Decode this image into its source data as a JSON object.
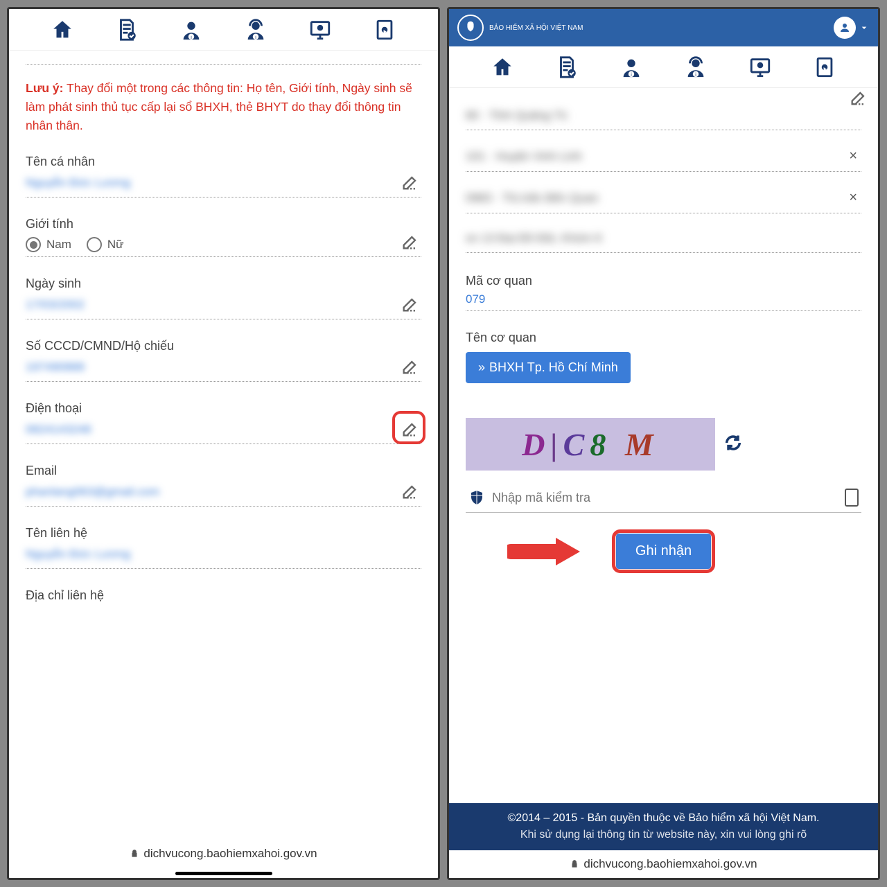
{
  "left": {
    "note_bold": "Lưu ý:",
    "note_text": " Thay đổi một trong các thông tin: Họ tên, Giới tính, Ngày sinh sẽ làm phát sinh thủ tục cấp lại sổ BHXH, thẻ BHYT do thay đổi thông tin nhân thân.",
    "fields": {
      "name_label": "Tên cá nhân",
      "name_value": "Nguyễn Đức Lương",
      "gender_label": "Giới tính",
      "gender_male": "Nam",
      "gender_female": "Nữ",
      "dob_label": "Ngày sinh",
      "dob_value": "17/03/2002",
      "id_label": "Số CCCD/CMND/Hộ chiếu",
      "id_value": "197490888",
      "phone_label": "Điện thoại",
      "phone_value": "0824143248",
      "email_label": "Email",
      "email_value": "phanlang063@gmail.com",
      "contact_label": "Tên liên hệ",
      "contact_value": "Nguyễn Đức Lương",
      "address_label": "Địa chỉ liên hệ"
    },
    "url": "dichvucong.baohiemxahoi.gov.vn"
  },
  "right": {
    "org_name": "BẢO HIỂM XÃ HỘI VIỆT NAM",
    "blur1": "80 · Tỉnh Quảng Trị",
    "blur2": "101 · Huyện Vinh Linh",
    "blur3": "0983 · Thị trấn Bến Quan",
    "blur4": "sn 13 Đại Đồ Đội, Khóm 6",
    "code_label": "Mã cơ quan",
    "code_value": "079",
    "agency_label": "Tên cơ quan",
    "agency_value": "BHXH Tp. Hồ Chí Minh",
    "captcha_text": "DC8M",
    "captcha_placeholder": "Nhập mã kiểm tra",
    "submit": "Ghi nhận",
    "footer1": "©2014 – 2015 - Bản quyền thuộc về Bảo hiểm xã hội Việt Nam.",
    "footer2": "Khi sử dụng lại thông tin từ website này, xin vui lòng ghi rõ",
    "url": "dichvucong.baohiemxahoi.gov.vn"
  }
}
